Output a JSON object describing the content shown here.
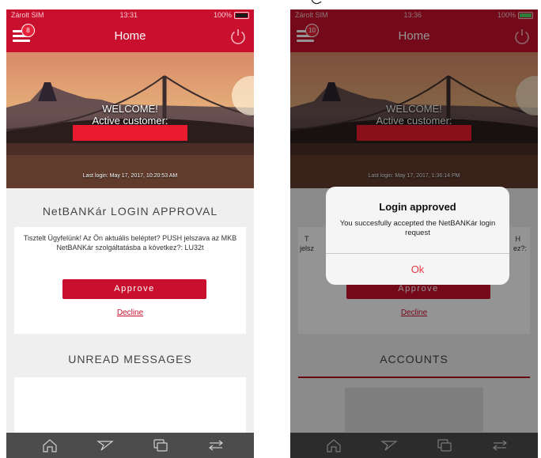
{
  "phones": [
    {
      "status": {
        "carrier": "Zárolt SIM",
        "time": "13:31",
        "battery": "100%"
      },
      "nav": {
        "title": "Home",
        "badge": "8"
      },
      "hero": {
        "welcome": "WELCOME!",
        "subtitle": "Active customer:",
        "last_login": "Last login: May 17, 2017, 10:20:53 AM"
      },
      "approval": {
        "title": "NetBANKár LOGIN APPROVAL",
        "message": "Tisztelt Ügyfelünk! Az Ön aktuális beléptet? PUSH jelszava az MKB NetBANKár szolgáltatásba a következ?: LU32t",
        "approve": "Approve",
        "decline": "Decline"
      },
      "section2": {
        "title": "UNREAD MESSAGES"
      }
    },
    {
      "status": {
        "carrier": "Zárolt SIM",
        "time": "13:36",
        "battery": "100%"
      },
      "nav": {
        "title": "Home",
        "badge": "10"
      },
      "hero": {
        "welcome": "WELCOME!",
        "subtitle": "Active customer:",
        "last_login": "Last login: May 17, 2017, 1:36:14 PM"
      },
      "approval": {
        "msg_left": "T",
        "msg_left2": "jelsz",
        "msg_right": "H",
        "msg_right2": "ez?:",
        "approve": "Approve",
        "decline": "Decline"
      },
      "section2": {
        "title": "ACCOUNTS"
      },
      "alert": {
        "title": "Login approved",
        "message": "You succesfully accepted the NetBANKár login request",
        "ok": "Ok"
      }
    }
  ],
  "tabbar_icons": [
    "home-icon",
    "send-icon",
    "cards-icon",
    "transfer-icon"
  ],
  "colors": {
    "brand_red": "#c8102e",
    "tabbar": "#4c4c4c",
    "alert_ok": "#e63946"
  }
}
